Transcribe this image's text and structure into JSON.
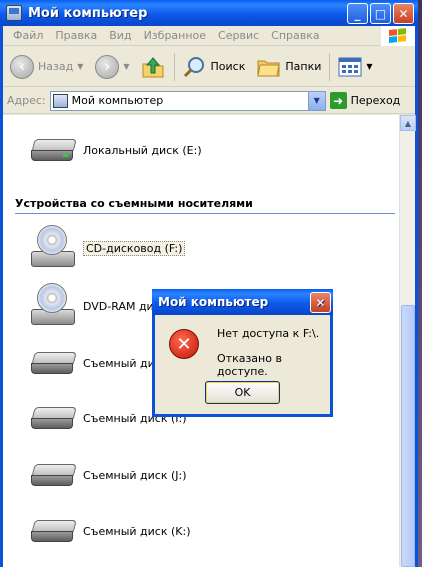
{
  "window": {
    "title": "Мой компьютер",
    "buttons": {
      "minimize": "_",
      "maximize": "□",
      "close": "✕"
    }
  },
  "menu": [
    "Файл",
    "Правка",
    "Вид",
    "Избранное",
    "Сервис",
    "Справка"
  ],
  "toolbar": {
    "back_label": "Назад",
    "search_label": "Поиск",
    "folders_label": "Папки"
  },
  "address": {
    "label": "Адрес:",
    "value": "Мой компьютер",
    "go_label": "Переход"
  },
  "drives": {
    "local": "Локальный диск (E:)",
    "section_title": "Устройства со съемными носителями",
    "cd": "CD-дисковод (F:)",
    "dvd": "DVD-RAM дисковод",
    "rem1": "Съемный диск",
    "rem2": "Съемный диск (I:)",
    "rem3": "Съемный диск (J:)",
    "rem4": "Съемный диск (K:)"
  },
  "dialog": {
    "title": "Мой компьютер",
    "message1": "Нет доступа к F:\\.",
    "message2": "Отказано в доступе.",
    "ok_label": "OK"
  },
  "colors": {
    "titlebar": "#0a5ef1",
    "error": "#c4130b",
    "go": "#2c9a2c"
  }
}
